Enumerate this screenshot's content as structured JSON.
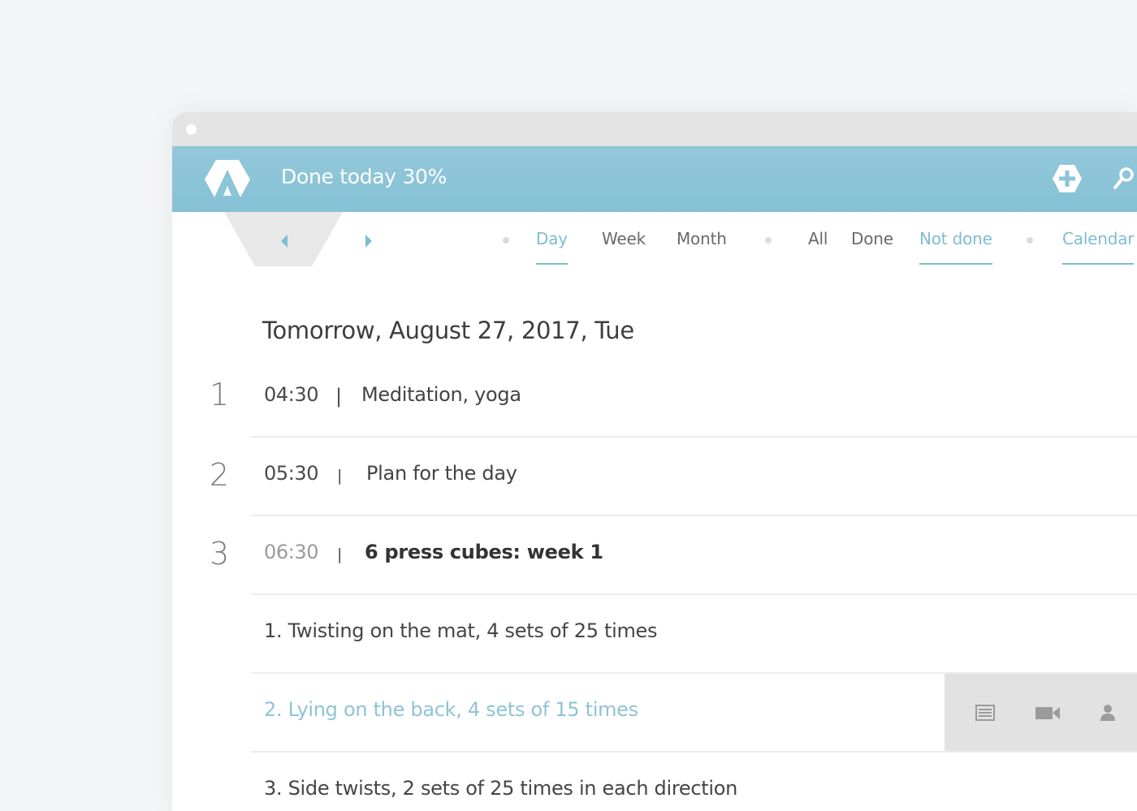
{
  "header": {
    "done_today": "Done today 30%"
  },
  "nav": {
    "period": [
      "Day",
      "Week",
      "Month"
    ],
    "filter": [
      "All",
      "Done",
      "Not done"
    ],
    "view": [
      "Calendar"
    ]
  },
  "date_title": "Tomorrow, August 27, 2017, Tue",
  "tasks": [
    {
      "num": "1",
      "time": "04:30",
      "sep": "|",
      "title": "Meditation, yoga"
    },
    {
      "num": "2",
      "time": "05:30",
      "sep": "|",
      "title": "Plan for the day"
    },
    {
      "num": "3",
      "time": "06:30",
      "sep": "|",
      "title": "6 press cubes: week 1"
    }
  ],
  "subtasks": [
    "1. Twisting on the mat, 4 sets of 25 times",
    "2. Lying on the back, 4 sets of 15 times",
    "3. Side twists, 2 sets of 25 times in each direction"
  ],
  "colors": {
    "accent": "#7fbcd2",
    "header_bg": "#8cc5d8",
    "actions_bg": "#e2e2e2"
  },
  "icons": {
    "logo": "logo-icon",
    "add": "plus-circle-icon",
    "search": "search-icon",
    "prev": "chevron-left-icon",
    "next": "chevron-right-icon",
    "notes": "list-icon",
    "video": "video-icon",
    "person": "person-icon"
  }
}
